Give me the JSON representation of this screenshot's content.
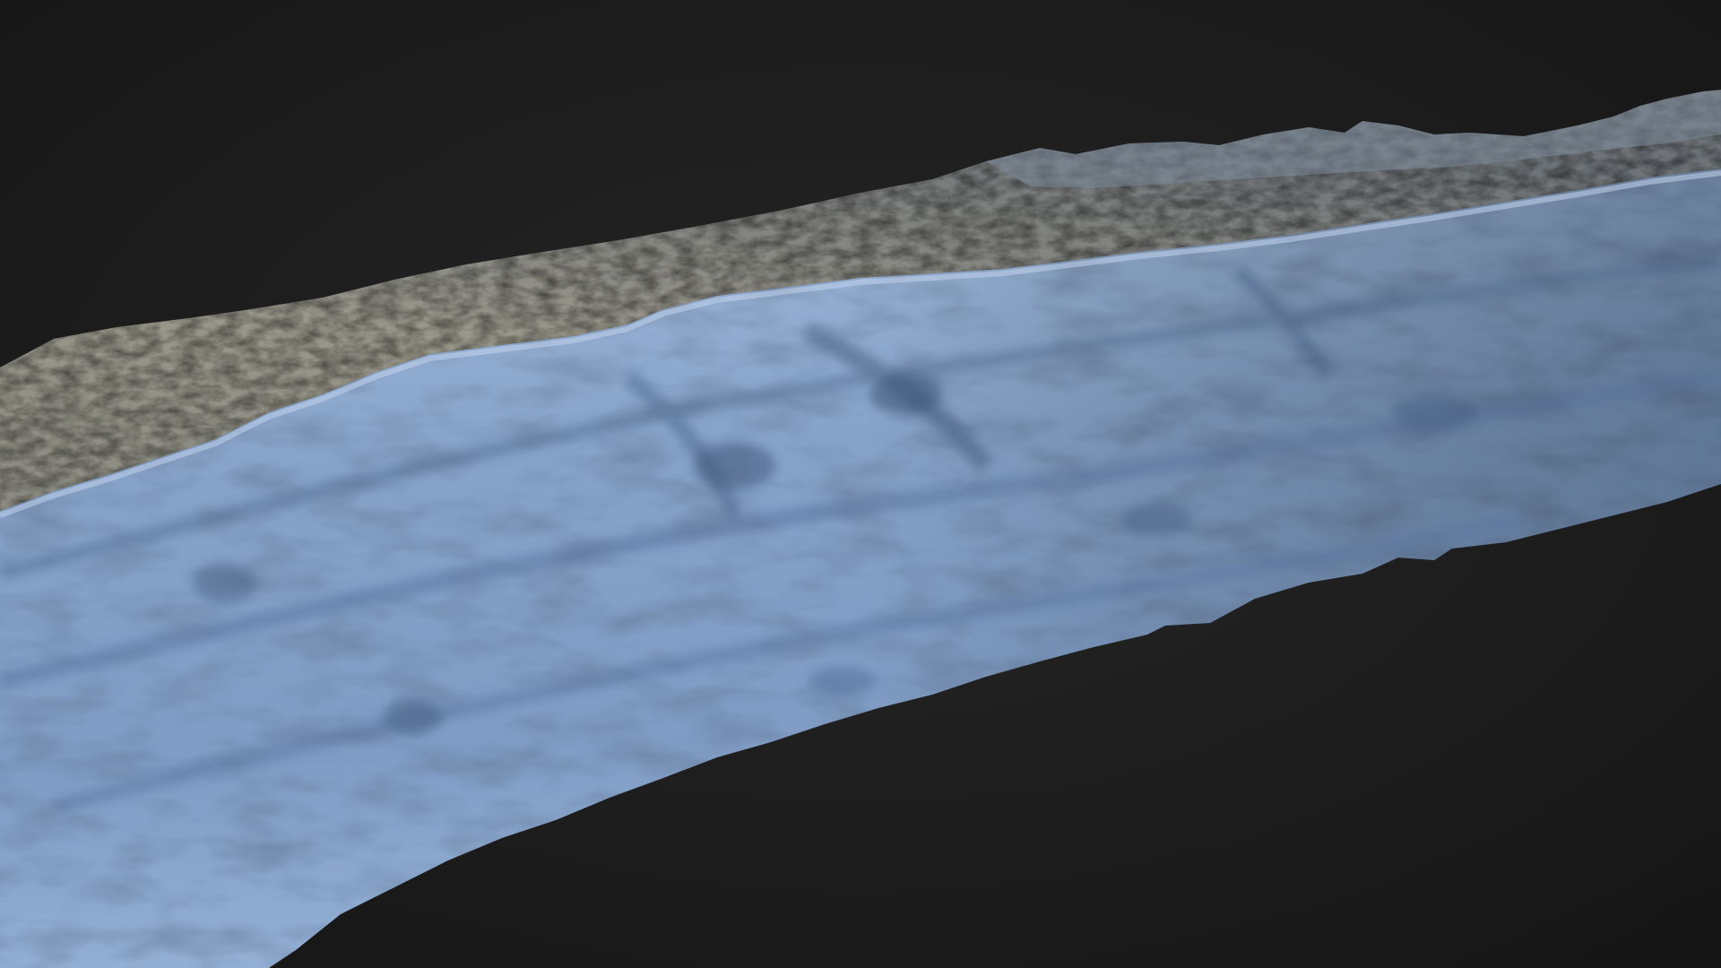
{
  "viewer": {
    "background_color": "#1a1a1a",
    "background_center_color": "#262626"
  },
  "model": {
    "type": "3d-mesh-scan",
    "subject": "trench-wall",
    "colors": {
      "wall_highlight": "#a3bcdc",
      "wall_mid": "#7f9cc4",
      "wall_shadow": "#4f6a90",
      "ground_light": "#a8a79a",
      "ground_mid": "#8c8a7c",
      "ground_dark": "#5b5c58",
      "far_edge": "#7d8c9c"
    }
  }
}
